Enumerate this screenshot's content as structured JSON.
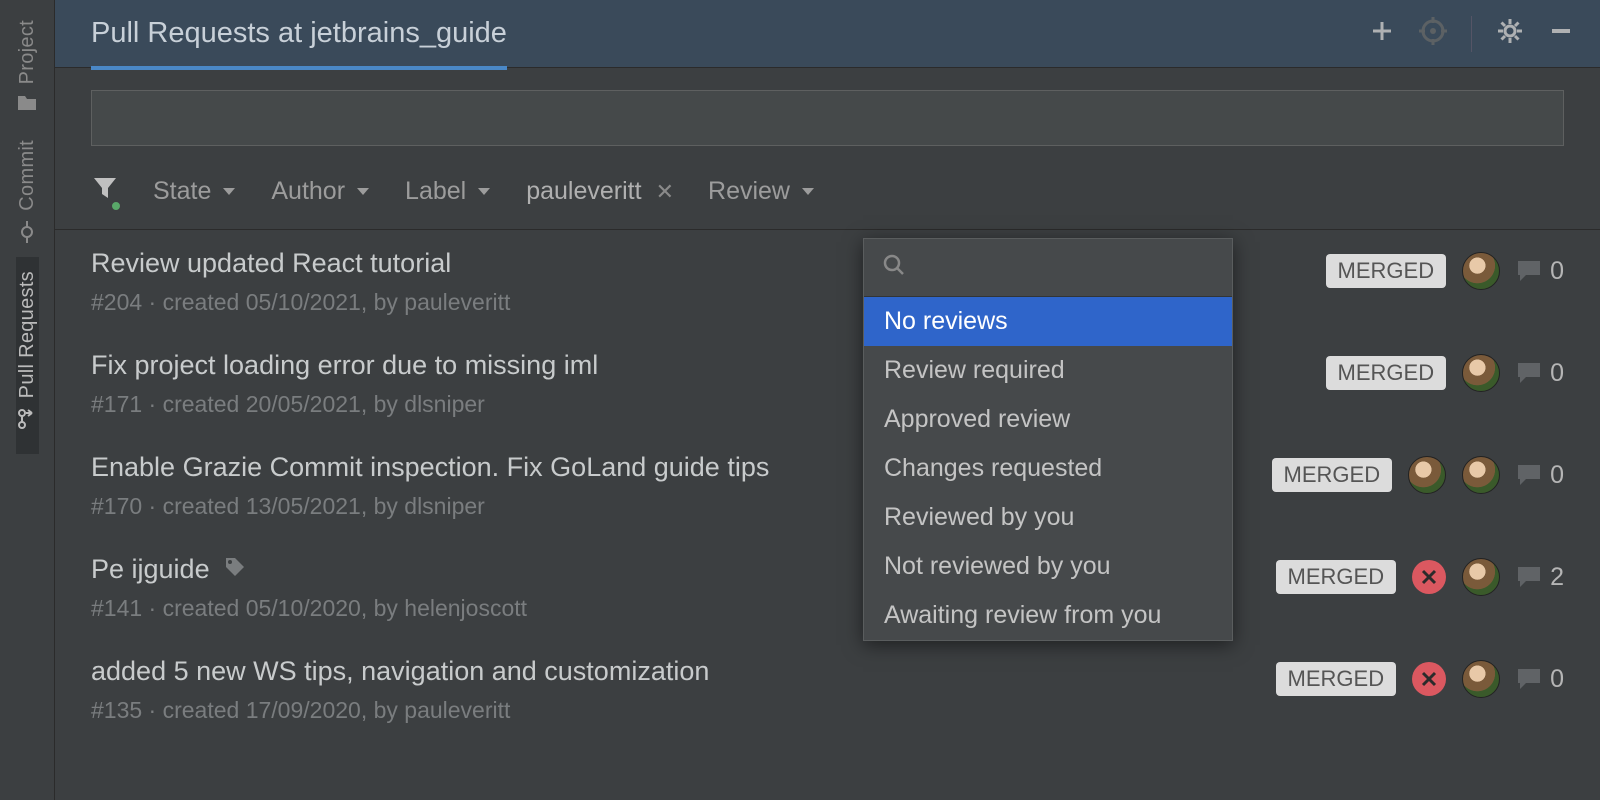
{
  "header": {
    "title": "Pull Requests at jetbrains_guide"
  },
  "sidebar": {
    "tabs": [
      {
        "label": "Project"
      },
      {
        "label": "Commit"
      },
      {
        "label": "Pull Requests"
      }
    ]
  },
  "filters": {
    "state": "State",
    "author": "Author",
    "label": "Label",
    "chip_value": "pauleveritt",
    "review": "Review"
  },
  "dropdown": {
    "items": [
      "No reviews",
      "Review required",
      "Approved review",
      "Changes requested",
      "Reviewed by you",
      "Not reviewed by you",
      "Awaiting review from you"
    ]
  },
  "prs": [
    {
      "title": "Review updated React tutorial",
      "meta": "#204 · created 05/10/2021, by pauleveritt",
      "status": "MERGED",
      "tag": false,
      "fail": false,
      "avatars": 1,
      "comments": "0"
    },
    {
      "title": "Fix project loading error due to missing iml",
      "meta": "#171 · created 20/05/2021, by dlsniper",
      "status": "MERGED",
      "tag": false,
      "fail": false,
      "avatars": 1,
      "comments": "0"
    },
    {
      "title": "Enable Grazie Commit inspection. Fix GoLand guide tips",
      "meta": "#170 · created 13/05/2021, by dlsniper",
      "status": "MERGED",
      "tag": false,
      "fail": false,
      "avatars": 2,
      "comments": "0"
    },
    {
      "title": "Pe ijguide",
      "meta": "#141 · created 05/10/2020, by helenjoscott",
      "status": "MERGED",
      "tag": true,
      "fail": true,
      "avatars": 1,
      "comments": "2"
    },
    {
      "title": "added 5 new WS tips, navigation and customization",
      "meta": "#135 · created 17/09/2020, by pauleveritt",
      "status": "MERGED",
      "tag": false,
      "fail": true,
      "avatars": 1,
      "comments": "0"
    }
  ]
}
